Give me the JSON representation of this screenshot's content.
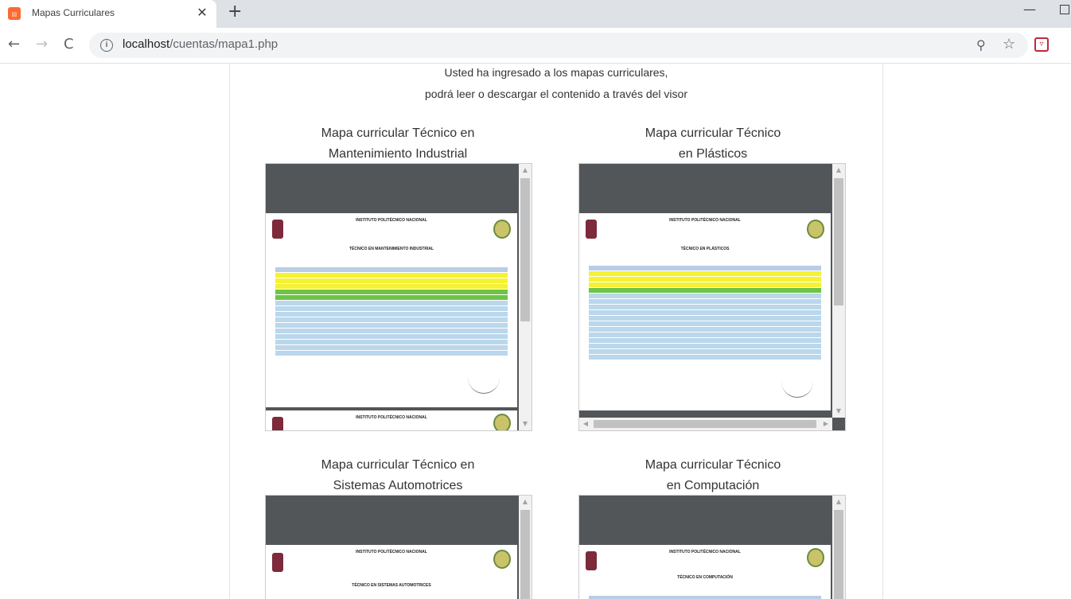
{
  "browser": {
    "tab_title": "Mapas Curriculares",
    "tab_close": "✕",
    "new_tab": "+",
    "url_host": "localhost",
    "url_path": "/cuentas/mapa1.php",
    "favicon_glyph": "☒"
  },
  "page": {
    "intro_line1": "Usted ha ingresado a los mapas curriculares,",
    "intro_line2": "podrá leer o descargar el contenido a través del visor"
  },
  "cards": [
    {
      "title_line1": "Mapa curricular Técnico en",
      "title_line2": "Mantenimiento Industrial",
      "doc_institution": "INSTITUTO POLITÉCNICO NACIONAL",
      "doc_career": "TÉCNICO EN MANTENIMIENTO INDUSTRIAL"
    },
    {
      "title_line1": "Mapa curricular Técnico",
      "title_line2": "en Plásticos",
      "doc_institution": "INSTITUTO POLITÉCNICO NACIONAL",
      "doc_career": "TÉCNICO EN PLÁSTICOS"
    },
    {
      "title_line1": "Mapa curricular Técnico en",
      "title_line2": "Sistemas Automotrices",
      "doc_institution": "INSTITUTO POLITÉCNICO NACIONAL",
      "doc_career": "TÉCNICO EN SISTEMAS AUTOMOTRICES"
    },
    {
      "title_line1": "Mapa curricular Técnico",
      "title_line2": "en Computación",
      "doc_institution": "INSTITUTO POLITÉCNICO NACIONAL",
      "doc_career": "TÉCNICO EN COMPUTACIÓN"
    }
  ]
}
